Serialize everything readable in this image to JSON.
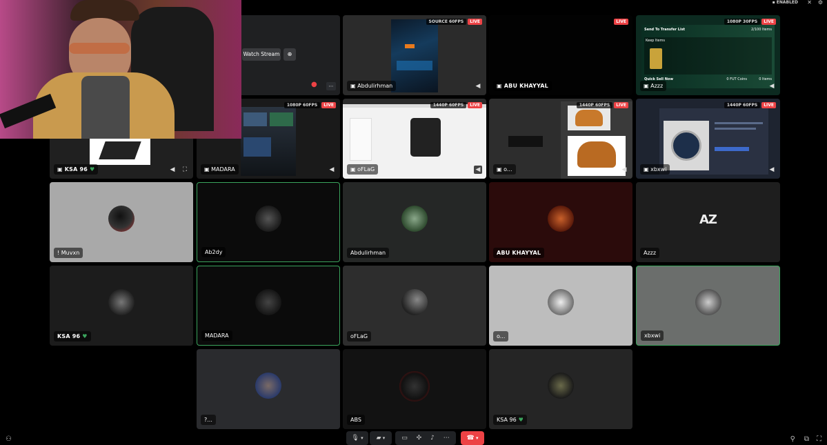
{
  "topbar": {
    "status": "ENABLED",
    "status_icon": "lock-icon"
  },
  "watch_stream": {
    "label": "Watch Stream"
  },
  "streams": [
    {
      "name": "Abdulirhman",
      "quality": "SOURCE 60FPS",
      "live": "LIVE"
    },
    {
      "name": "ABU KHAYYAL",
      "quality": "",
      "live": "LIVE"
    },
    {
      "name": "Azzz",
      "quality": "1080P 30FPS",
      "live": "LIVE",
      "content": {
        "header": "Send To Transfer List",
        "count": "2/100 Items",
        "keep": "Keep Items",
        "quick_sell": "Quick Sell Now",
        "coins": "0 FUT Coins",
        "items": "0 Items"
      }
    },
    {
      "name": "KSA 96",
      "quality": "",
      "live": ""
    },
    {
      "name": "MADARA",
      "quality": "1080P 60FPS",
      "live": "LIVE"
    },
    {
      "name": "oFLaG",
      "quality": "1440P 60FPS",
      "live": "LIVE"
    },
    {
      "name": "o...",
      "quality": "1440P 60FPS",
      "live": "LIVE"
    },
    {
      "name": "xbxwi",
      "quality": "1440P 60FPS",
      "live": "LIVE"
    }
  ],
  "participants": [
    {
      "name": "! Muvxn",
      "bg": "#a9a9a9"
    },
    {
      "name": "Ab2dy",
      "bg": "#0b0b0b"
    },
    {
      "name": "Abdulirhman",
      "bg": "#252726"
    },
    {
      "name": "ABU KHAYYAL",
      "bg": "#2b0b0b"
    },
    {
      "name": "Azzz",
      "bg": "#1e1e1e",
      "logo": "AZ"
    },
    {
      "name": "KSA 96",
      "bg": "#1c1c1c"
    },
    {
      "name": "MADARA",
      "bg": "#0b0b0b"
    },
    {
      "name": "oFLaG",
      "bg": "#2d2d2d"
    },
    {
      "name": "o...",
      "bg": "#bdbdbd"
    },
    {
      "name": "xbxwi",
      "bg": "#6b6e6c"
    },
    {
      "name": "?...",
      "bg": "#2a2b2e"
    },
    {
      "name": "ABS",
      "bg": "#121212"
    },
    {
      "name": "KSA 96",
      "bg": "#252525"
    }
  ],
  "controls": {
    "mic_icon": "microphone-icon",
    "camera_icon": "camera-off-icon",
    "share_icon": "screen-share-icon",
    "activities_icon": "activities-icon",
    "soundboard_icon": "soundboard-icon",
    "more_icon": "more-icon",
    "disconnect_icon": "phone-hangup-icon",
    "disconnect_color": "#ed4245"
  },
  "colors": {
    "speaking": "#3ba55d",
    "live": "#ed4245",
    "accent": "#5865f2"
  }
}
